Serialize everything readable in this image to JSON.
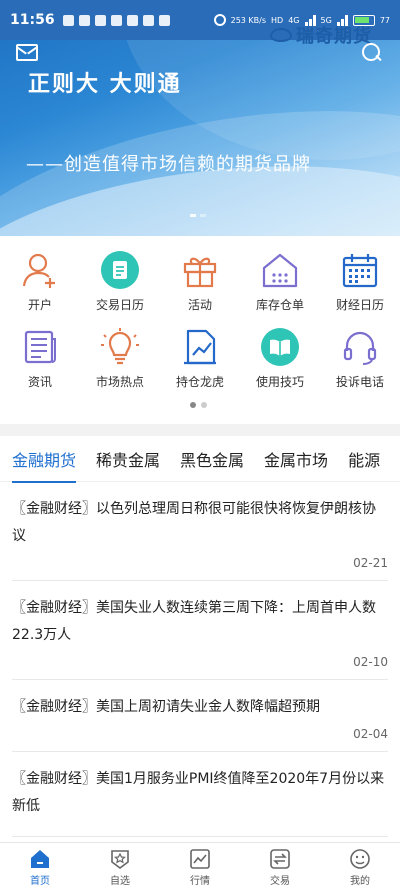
{
  "status_bar": {
    "time": "11:56",
    "net_speed": "253 KB/s",
    "hd": "HD",
    "net_type_1": "4G",
    "net_type_2": "5G",
    "battery": "77"
  },
  "brand": {
    "name": "瑞奇期货"
  },
  "hero": {
    "slogan": "正则大 大则通",
    "subslogan": "——创造值得市场信赖的期货品牌"
  },
  "quick_actions": [
    {
      "label": "开户",
      "icon": "user-add-icon"
    },
    {
      "label": "交易日历",
      "icon": "calendar-doc-icon"
    },
    {
      "label": "活动",
      "icon": "gift-icon"
    },
    {
      "label": "库存仓单",
      "icon": "warehouse-icon"
    },
    {
      "label": "财经日历",
      "icon": "calendar-grid-icon"
    },
    {
      "label": "资讯",
      "icon": "news-icon"
    },
    {
      "label": "市场热点",
      "icon": "lightbulb-icon"
    },
    {
      "label": "持仓龙虎",
      "icon": "chart-doc-icon"
    },
    {
      "label": "使用技巧",
      "icon": "book-icon"
    },
    {
      "label": "投诉电话",
      "icon": "headset-icon"
    }
  ],
  "tabs": [
    "金融期货",
    "稀贵金属",
    "黑色金属",
    "金属市场",
    "能源"
  ],
  "news": [
    {
      "title": "〖金融财经〗以色列总理周日称很可能很快将恢复伊朗核协议",
      "date": "02-21"
    },
    {
      "title": "〖金融财经〗美国失业人数连续第三周下降：上周首申人数22.3万人",
      "date": "02-10"
    },
    {
      "title": "〖金融财经〗美国上周初请失业金人数降幅超预期",
      "date": "02-04"
    },
    {
      "title": "〖金融财经〗美国1月服务业PMI终值降至2020年7月份以来新低",
      "date": ""
    }
  ],
  "bottom_nav": [
    {
      "label": "首页",
      "icon": "home-icon"
    },
    {
      "label": "自选",
      "icon": "star-shield-icon"
    },
    {
      "label": "行情",
      "icon": "chart-icon"
    },
    {
      "label": "交易",
      "icon": "exchange-icon"
    },
    {
      "label": "我的",
      "icon": "profile-face-icon"
    }
  ],
  "colors": {
    "accent": "#1f6fcf",
    "orange": "#e27a4c",
    "purple": "#7a6fcf",
    "teal": "#2ec4b6",
    "blue": "#2469c9"
  }
}
